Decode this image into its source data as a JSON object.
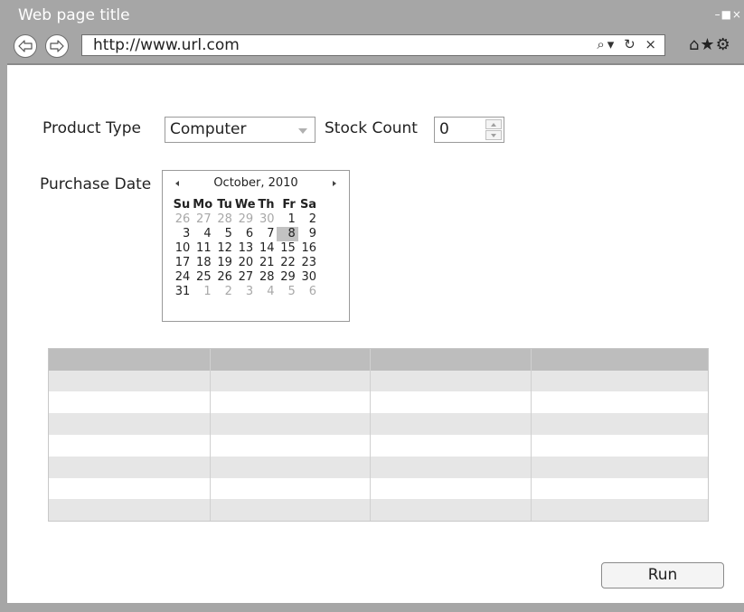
{
  "window": {
    "title": "Web page title",
    "controls": "–■×"
  },
  "toolbar": {
    "url": "http://www.url.com",
    "url_icons": "⌕▾ ↻ ×",
    "browser_icons": "⌂★⚙"
  },
  "form": {
    "product_type_label": "Product Type",
    "product_type_value": "Computer",
    "stock_count_label": "Stock Count",
    "stock_count_value": "0",
    "purchase_date_label": "Purchase Date"
  },
  "calendar": {
    "month_label": "October, 2010",
    "weekdays": [
      "Su",
      "Mo",
      "Tu",
      "We",
      "Th",
      "Fr",
      "Sa"
    ],
    "weeks": [
      [
        "26",
        "27",
        "28",
        "29",
        "30",
        "1",
        "2"
      ],
      [
        "3",
        "4",
        "5",
        "6",
        "7",
        "8",
        "9"
      ],
      [
        "10",
        "11",
        "12",
        "13",
        "14",
        "15",
        "16"
      ],
      [
        "17",
        "18",
        "19",
        "20",
        "21",
        "22",
        "23"
      ],
      [
        "24",
        "25",
        "26",
        "27",
        "28",
        "29",
        "30"
      ],
      [
        "31",
        "1",
        "2",
        "3",
        "4",
        "5",
        "6"
      ]
    ],
    "selected_day": "8"
  },
  "table": {
    "columns": 4,
    "rows": 7,
    "header_color": "#bdbdbd",
    "stripe_color": "#e6e6e6",
    "row_color": "#ffffff"
  },
  "actions": {
    "run_label": "Run"
  },
  "colors": {
    "chrome": "#a6a6a6",
    "content_bg": "#ffffff",
    "selected_day_bg": "#c2c2c2"
  },
  "icons": [
    "back-arrow-icon",
    "forward-arrow-icon",
    "search-icon",
    "refresh-icon",
    "close-icon",
    "home-icon",
    "star-icon",
    "gear-icon",
    "minimize-icon",
    "maximize-icon"
  ]
}
